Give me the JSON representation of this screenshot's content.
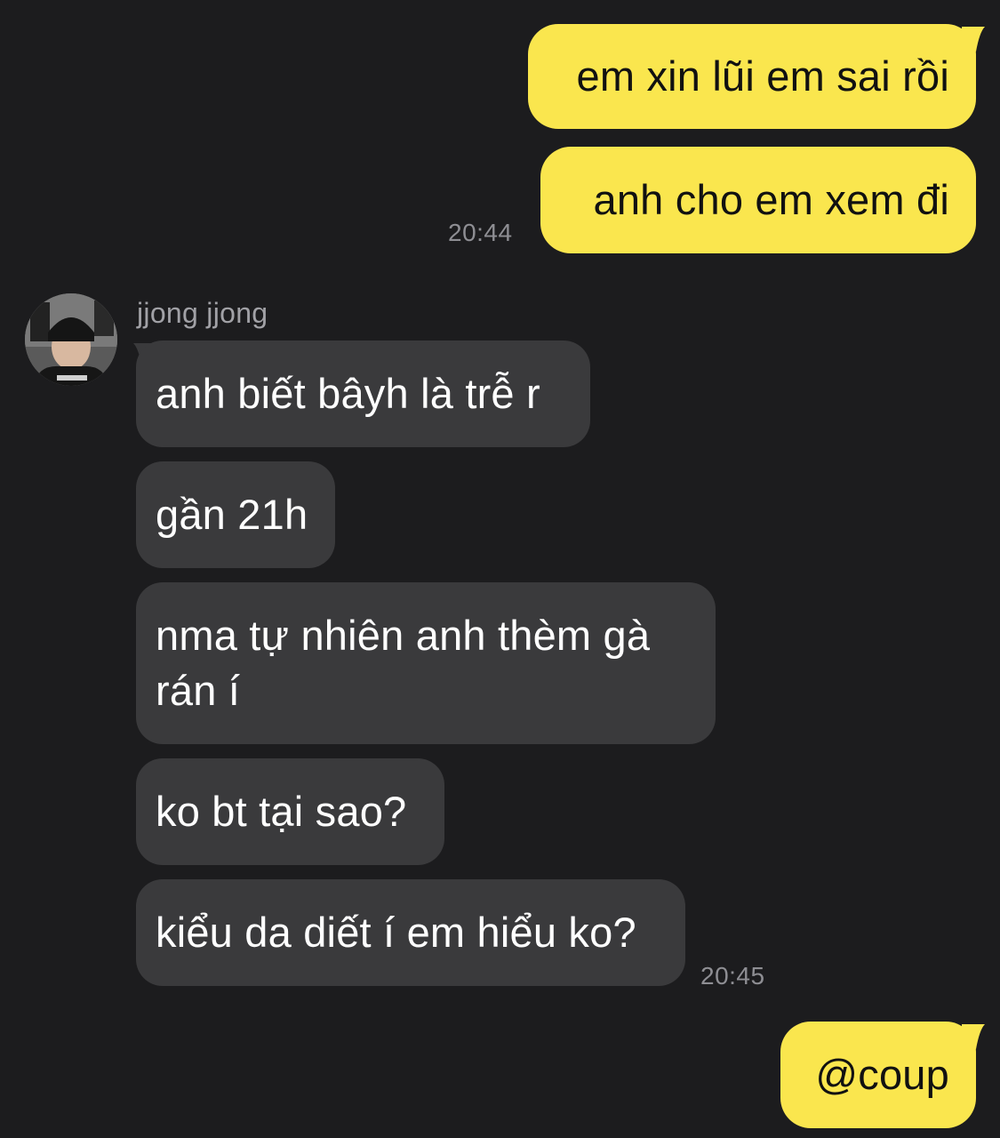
{
  "conversation": {
    "messages": [
      {
        "from": "me",
        "text": "em xin lũi em sai rồi"
      },
      {
        "from": "me",
        "text": "anh cho em xem đi",
        "time": "20:44"
      },
      {
        "from": "them",
        "text": "anh biết bâyh là trễ r"
      },
      {
        "from": "them",
        "text": "gần 21h"
      },
      {
        "from": "them",
        "text": "nma tự nhiên anh thèm gà rán í"
      },
      {
        "from": "them",
        "text": "ko bt tại sao?"
      },
      {
        "from": "them",
        "text": "kiểu da diết í em hiểu ko?",
        "time": "20:45"
      },
      {
        "from": "me",
        "text": "@coup"
      }
    ],
    "sender_name": "jjong jjong"
  },
  "colors": {
    "background": "#1c1c1e",
    "outgoing_bubble": "#fae64e",
    "incoming_bubble": "#3a3a3c",
    "timestamp": "#8e8e93"
  }
}
